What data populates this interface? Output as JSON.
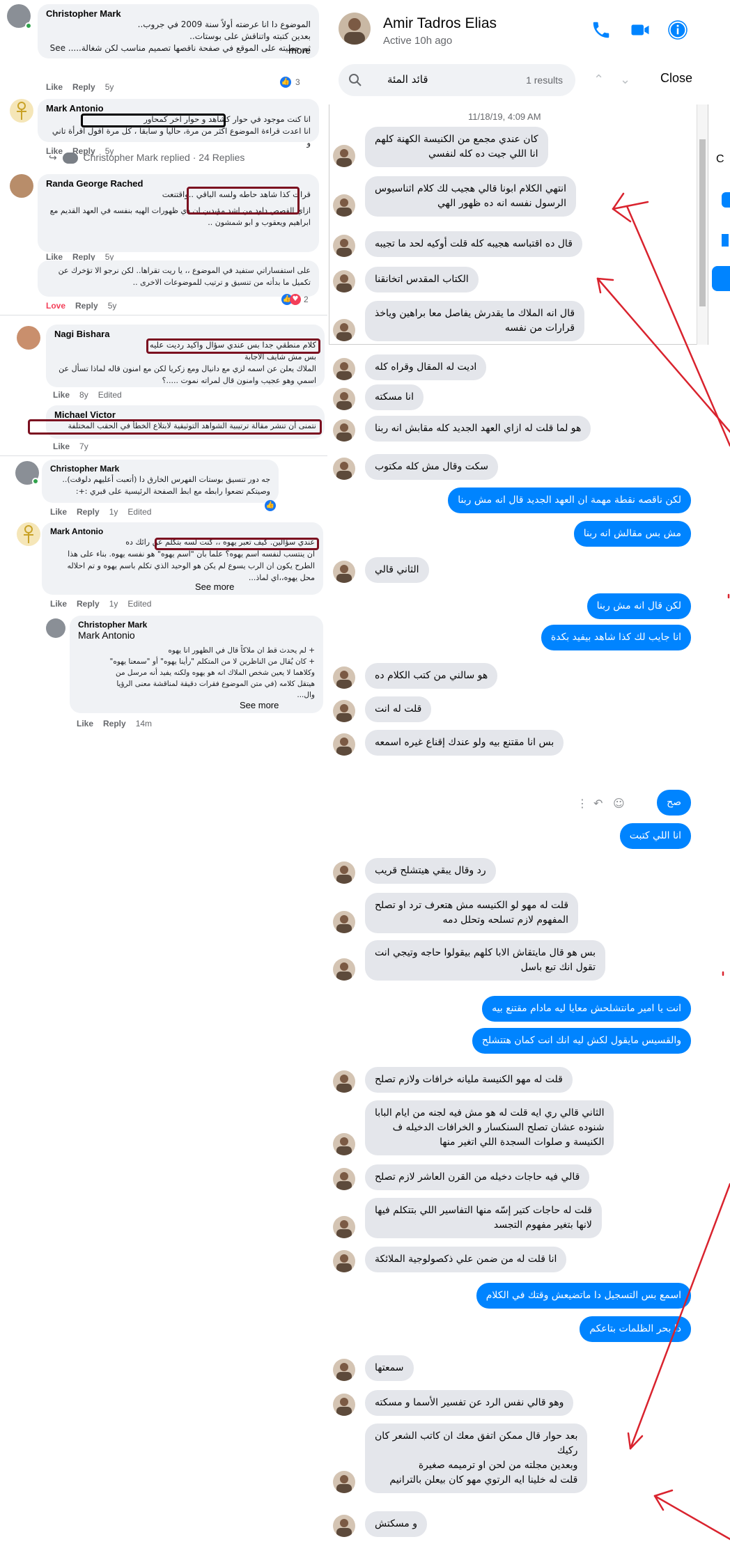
{
  "comments": [
    {
      "author": "Christopher Mark",
      "text": "الموضوع دا انا عرضته أولاً سنة 2009 في جروب..\nبعدين كتبته واتناقش على بوستات..\nثم حطيته على الموقع في صفحة ناقصها تصميم مناسب لكن شغالة..... See",
      "more": "more",
      "like": "Like",
      "reply": "Reply",
      "age": "5y",
      "reactions": "3"
    },
    {
      "author": "Mark Antonio",
      "highlight": "انا كنت موجود في حوار كشاهد و حوار اخر كمحاور",
      "text": "انا اعدت قراءة الموضوع اكثر من مرة، حاليا و سابقا ، كل مرة اقول اقرأة تاني و",
      "like": "Like",
      "reply": "Reply",
      "age": "5y"
    },
    {
      "replied": "Christopher Mark replied · 24 Replies"
    },
    {
      "author": "Randa George Rached",
      "highlight": "قرات كذا شاهد حاطه ولسه الباقي ..واقتنعت",
      "text": "ازاي القصص داود من اشد مؤيدين ان دي ظهورات الهيه بنفسه في العهد القديم مع ابراهيم ويعقوب و ابو شمشون ..",
      "like": "Like",
      "reply": "Reply",
      "age": "5y"
    },
    {
      "text": "على استفساراتي ستفيد في الموضوع ،، يا ريت تقراها.. لكن نرجو الا تؤخرك عن تكميل ما بدأته من تنسيق و ترتيب للموضوعات الاخرى ..",
      "like": "Love",
      "reply": "Reply",
      "age": "5y",
      "reactions": "2"
    },
    {
      "author": "Nagi Bishara",
      "highlight": "كلام منطقي جدا بس عندي سؤال واكيد رديت عليه",
      "text": "بس مش شايف الاجابة\nالملاك يعلن عن اسمه لزي مع دانيال ومع زكريا لكن مع امنون قاله لماذا تسأل عن اسمي وهو عجيب وامنون قال لمراته نموت .....؟",
      "like": "Like",
      "age": "8y",
      "edited": "Edited"
    },
    {
      "author": "Michael Victor",
      "highlight": "نتمنى أن تنشر مقالة ترتيبية الشواهد التوثيقية لابتلاع الخطأ في الحقب المختلفة",
      "like": "Like",
      "age": "7y"
    },
    {
      "author": "Christopher Mark",
      "text": "جه دور تنسيق بوستات الفهرس الخارق دا (أتعبت أعليهم دلوقت)..\nوصيتكم تضعوا رابطه مع ابط الصفحة الرئيسية على قبري :+:",
      "like": "Like",
      "reply": "Reply",
      "age": "1y",
      "edited": "Edited"
    },
    {
      "author": "Mark Antonio",
      "highlight": "عندي سؤالين. كيف تعبر يهوه ،، كنت لسه بتكلم عن رائك ده",
      "text": "ان ينتسب لنفسه اسم يهوه؟ علما بان \"اسم يهوه\" هو نفسه يهوه. بناء على هذا الطرح يكون ان الرب يسوع لم يكن هو الوحيد الذي تكلم باسم يهوه و تم احلاله محل يهوه،،اي لماذ...",
      "more": "See more",
      "like": "Like",
      "reply": "Reply",
      "age": "1y",
      "edited": "Edited"
    },
    {
      "author": "Christopher Mark",
      "mention": "Mark Antonio",
      "text": "+ لم يحدث قط ان ملاكاً قال في الظهور انا يهوه\n+ كان يُقال من الناظرين لا من المتكلم \"رأينا يهوه\" أو \"سمعنا يهوه\"\nوكلاهما لا يعين شخص الملاك انه هو يهوه ولكنه يفيد أنه مرسل من\nهيتقل كلامه (في متن الموضوع فقرات دقيقة لمناقشة معنى الرؤيا\nوال...",
      "more": "See more",
      "like": "Like",
      "reply": "Reply",
      "age": "14m"
    }
  ],
  "messenger": {
    "contact_name": "Amir Tadros Elias",
    "status": "Active 10h ago",
    "search_query": "قائد المئة",
    "search_results": "1 results",
    "close_label": "Close",
    "timestamp": "11/18/19, 4:09 AM",
    "side_letter": "C",
    "messages": [
      {
        "dir": "in",
        "text": "كان عندي مجمع من الكنيسة الكهنة كلهم\nانا اللي جيت ده كله لنفسي"
      },
      {
        "dir": "in",
        "text": "انتهي الكلام ابونا قالي هجيب لك كلام اثناسيوس\nالرسول نفسه انه ده ظهور الهي"
      },
      {
        "dir": "in",
        "text": "قال ده اقتباسه هجيبه كله قلت أوكيه لحد ما تجيبه"
      },
      {
        "dir": "in",
        "text": "الكتاب المقدس اتخانقنا"
      },
      {
        "dir": "in",
        "text": "قال انه الملاك ما يقدرش يفاصل معا براهين وياخذ\nقرارات من نفسه"
      },
      {
        "dir": "in",
        "text": "اديت له المقال وقراه كله"
      },
      {
        "dir": "in",
        "text": "انا مسكته"
      },
      {
        "dir": "in",
        "text": "هو لما قلت له ازاي العهد الجديد كله مقابش انه ربنا"
      },
      {
        "dir": "in",
        "text": "سكت وقال مش كله مكتوب"
      },
      {
        "dir": "out",
        "text": "لكن ناقصه نقطة مهمة ان العهد الجديد قال انه مش ربنا"
      },
      {
        "dir": "out",
        "text": "مش بس مقالش انه ربنا"
      },
      {
        "dir": "in",
        "text": "الثاني قالي"
      },
      {
        "dir": "out",
        "text": "لكن قال انه مش ربنا"
      },
      {
        "dir": "out",
        "text": "انا جايب لك كذا شاهد بيفيد بكدة"
      },
      {
        "dir": "in",
        "text": "هو سالني من كتب الكلام ده"
      },
      {
        "dir": "in",
        "text": "قلت له انت"
      },
      {
        "dir": "in",
        "text": "بس انا مقتنع بيه ولو عندك إقناع غيره اسمعه"
      },
      {
        "dir": "out",
        "text": "صح"
      },
      {
        "dir": "out",
        "text": "انا اللي كتبت"
      },
      {
        "dir": "in",
        "text": "رد وقال يبقي هيتشلح قريب"
      },
      {
        "dir": "in",
        "text": "قلت له مهو لو الكنيسه مش هتعرف ترد او تصلح\nالمفهوم لازم تسلحه وتحلل دمه"
      },
      {
        "dir": "in",
        "text": "بس هو قال مايتقاش الابا كلهم بيقولوا حاجه وتيجي انت\nتقول انك تبع باسل"
      },
      {
        "dir": "out",
        "text": "انت يا امير مانتشلحش معايا ليه مادام مقتنع بيه"
      },
      {
        "dir": "out",
        "text": "والقسيس مايقول لكش ليه انك انت كمان هتتشلح"
      },
      {
        "dir": "in",
        "text": "قلت له مهو الكنيسة مليانه خرافات ولازم تصلح"
      },
      {
        "dir": "in",
        "text": "الثاني قالي ري ايه قلت له هو مش فيه لجنه من ايام البابا\nشنوده عشان تصلح السنكسار و الخرافات الدخيله ف\nالكنيسة و صلوات السجدة اللي اتغير منها"
      },
      {
        "dir": "in",
        "text": "قالي فيه حاجات دخيله من القرن العاشر لازم تصلح"
      },
      {
        "dir": "in",
        "text": "قلت له حاجات كتير إسّه منها التفاسير اللي بتتكلم فيها\nلانها بتغير مفهوم التجسد"
      },
      {
        "dir": "in",
        "text": "انا قلت له من ضمن علي ذكصولوجية الملائكة"
      },
      {
        "dir": "out",
        "text": "اسمع بس التسجيل دا ماتضيعش وقتك في الكلام"
      },
      {
        "dir": "out",
        "text": "دا بحر الظلمات بتاعكم"
      },
      {
        "dir": "in",
        "text": "سمعتها"
      },
      {
        "dir": "in",
        "text": "وهو قالي نفس الرد عن تفسير الأسما و مسكته"
      },
      {
        "dir": "in",
        "text": "بعد حوار قال ممكن اتفق معك ان كاتب الشعر كان\nركيك\nوبعدين مجلته من لحن او ترميمه صغيرة\nقلت له خلينا ايه الرتوي مهو كان بيعلن بالترانيم"
      },
      {
        "dir": "in",
        "text": "و مسكتش"
      }
    ]
  },
  "colors": {
    "accent": "#0084ff",
    "incoming": "#e4e6eb",
    "annotation": "#d9232e",
    "highlight_box": "#7b1020"
  },
  "icons": [
    "search-icon",
    "phone-icon",
    "video-icon",
    "info-icon",
    "chevron-up-icon",
    "chevron-down-icon",
    "close-icon",
    "more-icon",
    "reply-icon",
    "emoji-icon"
  ]
}
